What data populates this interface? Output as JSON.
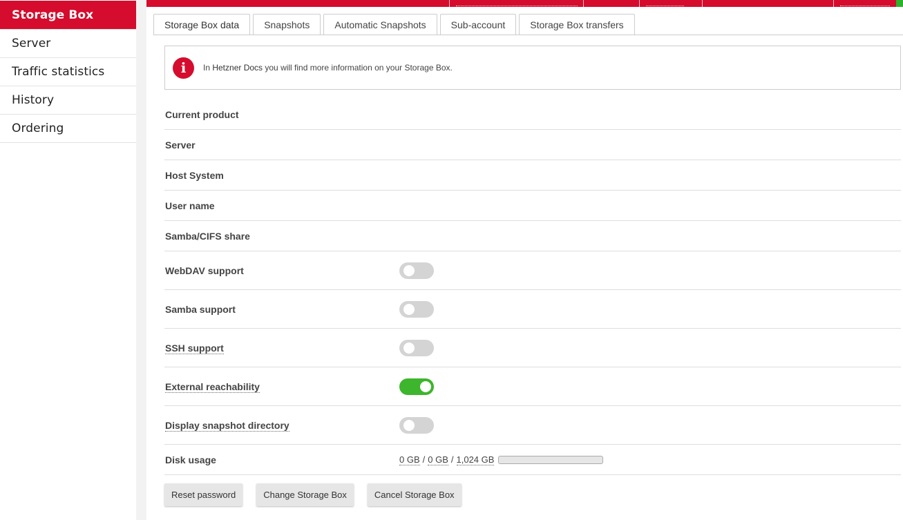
{
  "sidebar": {
    "items": [
      {
        "label": "Storage Box"
      },
      {
        "label": "Server"
      },
      {
        "label": "Traffic statistics"
      },
      {
        "label": "History"
      },
      {
        "label": "Ordering"
      }
    ]
  },
  "tabs": [
    {
      "label": "Storage Box data"
    },
    {
      "label": "Snapshots"
    },
    {
      "label": "Automatic Snapshots"
    },
    {
      "label": "Sub-account"
    },
    {
      "label": "Storage Box transfers"
    }
  ],
  "info": {
    "prefix": "In ",
    "link": "Hetzner Docs",
    "suffix": " you will find more information on your Storage Box.",
    "icon": "info-icon"
  },
  "rows": {
    "current_product": "Current product",
    "server": "Server",
    "host_system": "Host System",
    "user_name": "User name",
    "samba_share": "Samba/CIFS share",
    "webdav": {
      "label": "WebDAV support",
      "enabled": false
    },
    "samba": {
      "label": "Samba support",
      "enabled": false
    },
    "ssh": {
      "label": "SSH support",
      "enabled": false
    },
    "external": {
      "label": "External reachability",
      "enabled": true
    },
    "snapshot_dir": {
      "label": "Display snapshot directory",
      "enabled": false
    },
    "disk": {
      "label": "Disk usage",
      "used": "0 GB",
      "snapshots": "0 GB",
      "total": "1,024 GB",
      "slash": "/",
      "fraction": 0
    }
  },
  "buttons": {
    "reset": "Reset password",
    "change": "Change Storage Box",
    "cancel": "Cancel Storage Box"
  },
  "colors": {
    "accent": "#d50c2d",
    "toggle_on": "#3db52c",
    "toggle_off": "#d4d4d4"
  }
}
